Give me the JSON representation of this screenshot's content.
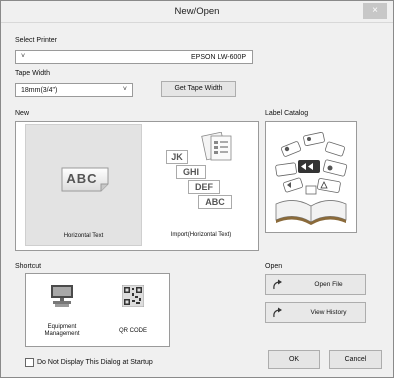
{
  "window": {
    "title": "New/Open",
    "close": "×"
  },
  "printer": {
    "label": "Select Printer",
    "value": "EPSON LW-600P"
  },
  "tape": {
    "label": "Tape Width",
    "value": "18mm(3/4\")",
    "button": "Get Tape Width"
  },
  "new_section": {
    "label": "New",
    "tiles": [
      {
        "label": "Horizontal Text",
        "preview": "ABC"
      },
      {
        "label": "Import(Horizontal Text)",
        "letters": [
          "JK",
          "GHI",
          "DEF",
          "ABC"
        ]
      }
    ]
  },
  "catalog": {
    "label": "Label Catalog"
  },
  "shortcut": {
    "label": "Shortcut",
    "items": [
      {
        "label": "Equipment Management"
      },
      {
        "label": "QR CODE"
      }
    ]
  },
  "open_section": {
    "label": "Open",
    "open_file": "Open File",
    "view_history": "View History"
  },
  "footer": {
    "startup_checkbox": "Do Not Display This Dialog at Startup",
    "ok": "OK",
    "cancel": "Cancel"
  }
}
